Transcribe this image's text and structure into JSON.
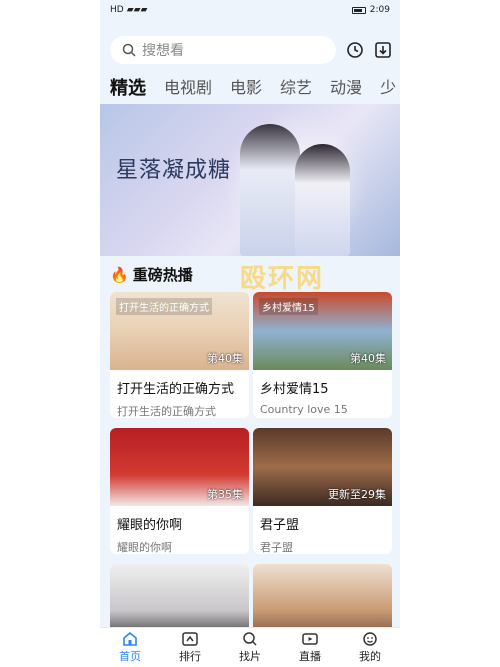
{
  "status": {
    "time": "2:09",
    "signal": "HD"
  },
  "search": {
    "placeholder": "搜想看"
  },
  "tabs": [
    "精选",
    "电视剧",
    "电影",
    "综艺",
    "动漫",
    "少"
  ],
  "banner": {
    "title": "星落凝成糖"
  },
  "section": {
    "title": "重磅热播"
  },
  "cards": [
    {
      "title": "打开生活的正确方式",
      "subtitle": "打开生活的正确方式",
      "badge": "第40集",
      "thumb_label": "打开生活的正确方式"
    },
    {
      "title": "乡村爱情15",
      "subtitle": "Country love 15",
      "badge": "第40集",
      "thumb_label": "乡村爱情15"
    },
    {
      "title": "耀眼的你啊",
      "subtitle": "耀眼的你啊",
      "badge": "第35集",
      "thumb_label": ""
    },
    {
      "title": "君子盟",
      "subtitle": "君子盟",
      "badge": "更新至29集",
      "thumb_label": ""
    },
    {
      "title": "",
      "subtitle": "",
      "badge": "",
      "thumb_label": ""
    },
    {
      "title": "",
      "subtitle": "",
      "badge": "",
      "thumb_label": ""
    }
  ],
  "nav": [
    "首页",
    "排行",
    "找片",
    "直播",
    "我的"
  ],
  "watermark": "殴环网",
  "colors": {
    "accent": "#2a86f6",
    "tab_underline": "#3aa0ff",
    "fire": "#ff5a2a"
  }
}
